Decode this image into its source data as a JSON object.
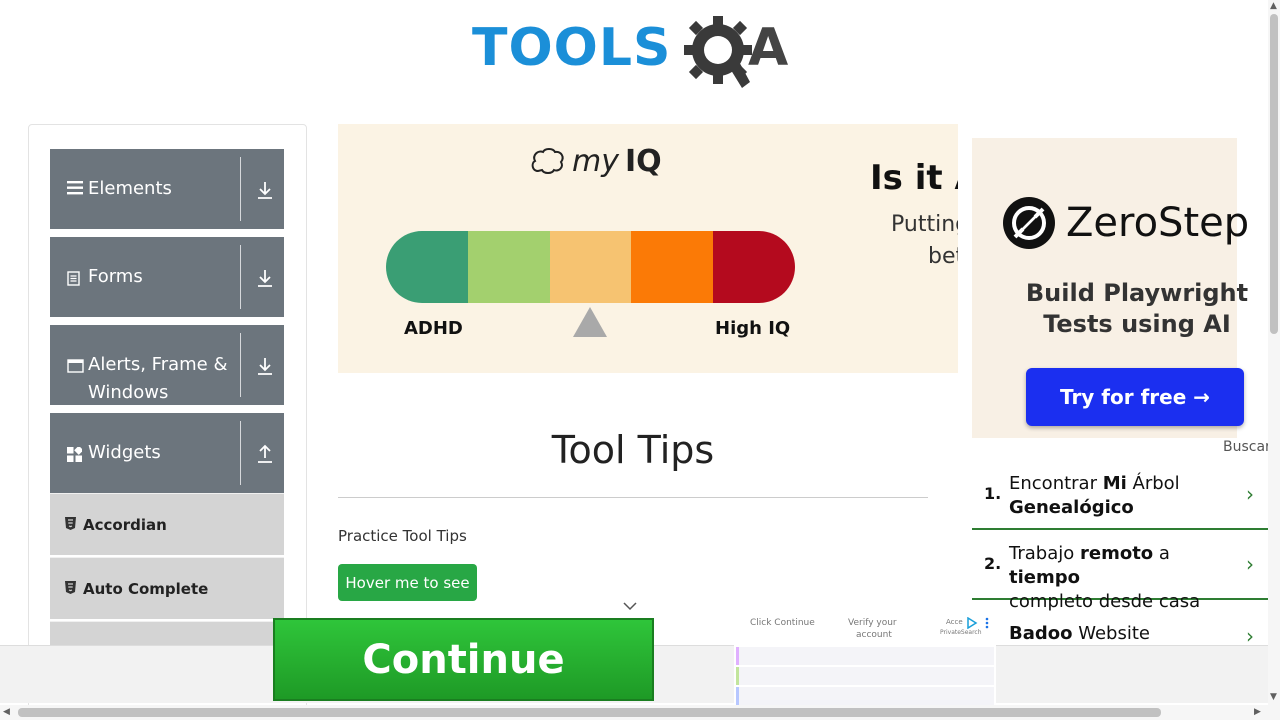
{
  "header": {
    "logo_main": "TOOLS",
    "logo_suffix": "A"
  },
  "sidebar": {
    "groups": [
      {
        "label": "Elements",
        "icon": "menu-icon",
        "arrow": "download-arrow-icon"
      },
      {
        "label": "Forms",
        "icon": "document-icon",
        "arrow": "download-arrow-icon"
      },
      {
        "label": "Alerts, Frame &",
        "label2": "Windows",
        "icon": "window-icon",
        "arrow": "download-arrow-icon"
      },
      {
        "label": "Widgets",
        "icon": "widgets-icon",
        "arrow": "upload-arrow-icon"
      }
    ],
    "subitems": [
      {
        "label": "Accordian",
        "icon": "html5-icon"
      },
      {
        "label": "Auto Complete",
        "icon": "html5-icon"
      }
    ]
  },
  "banner_ad": {
    "brand_prefix": "my",
    "brand_suffix": "IQ",
    "scale_left": "ADHD",
    "scale_right": "High IQ",
    "scale_colors": [
      "#3a9e74",
      "#a3d06e",
      "#f6c371",
      "#fb7a06",
      "#b40a1e"
    ],
    "headline": "Is it A",
    "sub1": "Putting",
    "sub2": "bet"
  },
  "main": {
    "title": "Tool Tips",
    "practice_label": "Practice Tool Tips",
    "hover_button": "Hover me to see"
  },
  "side_ad": {
    "brand": "ZeroStep",
    "tagline_1": "Build Playwright",
    "tagline_2": "Tests using AI",
    "cta": "Try for free →",
    "buscar": "Buscar",
    "results": [
      {
        "num": "1.",
        "text_a": "Encontrar ",
        "bold_a": "Mi",
        "text_b": " Árbol",
        "bold_b": "Genealógico",
        "text_c": ""
      },
      {
        "num": "2.",
        "text_a": "Trabajo ",
        "bold_a": "remoto",
        "text_b": " a ",
        "bold_b": "tiempo",
        "text_c": "completo desde casa"
      },
      {
        "num": "",
        "text_a": "",
        "bold_a": "Badoo",
        "text_b": " Website",
        "bold_b": "",
        "text_c": ""
      }
    ]
  },
  "bottom_ad": {
    "continue_label": "Continue",
    "step1": "Click Continue",
    "step2": "Verify your",
    "step2b": "account",
    "step3": "Acce",
    "step3b": "PrivateSearch"
  },
  "colors": {
    "accent_blue": "#1b8fd8",
    "sidebar_gray": "#6c757d",
    "button_green": "#28a745",
    "cta_blue": "#1b2ff0"
  }
}
